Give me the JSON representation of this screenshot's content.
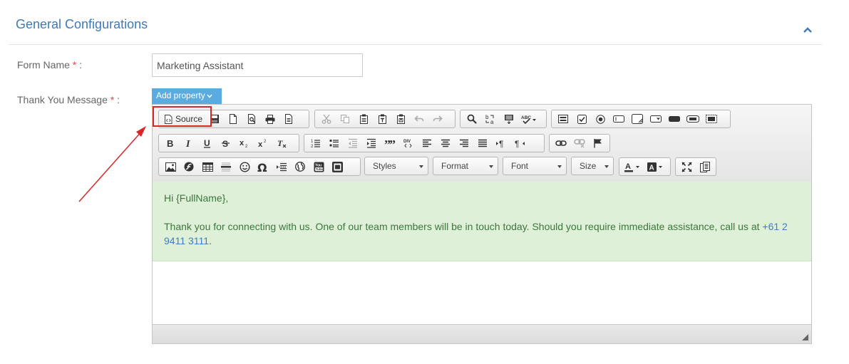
{
  "section": {
    "title": "General Configurations"
  },
  "form": {
    "name_label": "Form Name",
    "name_value": "Marketing Assistant",
    "thanks_label": "Thank You Message",
    "required_mark": "*",
    "label_colon": ":"
  },
  "add_property": {
    "label": "Add property"
  },
  "toolbar": {
    "source_label": "Source",
    "styles_label": "Styles",
    "format_label": "Format",
    "font_label": "Font",
    "size_label": "Size"
  },
  "editor": {
    "greeting": "Hi {FullName},",
    "message": "Thank you for connecting with us. One of our team members will be in touch today. Should you require immediate assistance, call us at ",
    "phone": "+61 2 9411 3111",
    "message_end": "."
  },
  "colors": {
    "title_blue": "#3d7ab8",
    "button_blue": "#5aabdf",
    "success_bg": "#dff0d8",
    "success_text": "#3c763d",
    "highlight_red": "#d62828"
  }
}
